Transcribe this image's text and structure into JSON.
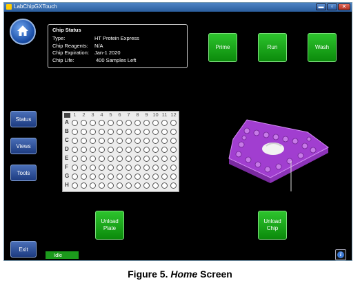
{
  "window": {
    "title": "LabChipGXTouch",
    "controls": {
      "minimize": "▬",
      "maximize": "▫",
      "close": "✕"
    }
  },
  "sidebar": {
    "items": [
      {
        "label": "Status"
      },
      {
        "label": "Views"
      },
      {
        "label": "Tools"
      }
    ],
    "exit_label": "Exit"
  },
  "chip_status": {
    "heading": "Chip Status",
    "rows": [
      {
        "key": "Type:",
        "value": "HT Protein Express"
      },
      {
        "key": "Chip Reagents:",
        "value": "N/A"
      },
      {
        "key": "Chip Expiration:",
        "value": "Jan-1 2020"
      },
      {
        "key": "Chip Life:",
        "value": "400 Samples Left"
      }
    ]
  },
  "actions": {
    "prime": "Prime",
    "run": "Run",
    "wash": "Wash",
    "unload_plate": [
      "Unload",
      "Plate"
    ],
    "unload_chip": [
      "Unload",
      "Chip"
    ]
  },
  "plate": {
    "columns": [
      "1",
      "2",
      "3",
      "4",
      "5",
      "6",
      "7",
      "8",
      "9",
      "10",
      "11",
      "12"
    ],
    "rows": [
      "A",
      "B",
      "C",
      "D",
      "E",
      "F",
      "G",
      "H"
    ]
  },
  "status": {
    "text": "Idle"
  },
  "info_icon": "i",
  "caption": {
    "prefix": "Figure 5. ",
    "emph": "Home",
    "suffix": " Screen"
  },
  "colors": {
    "action_green": "#1aa81a",
    "nav_blue": "#2a4f9c",
    "chip_purple": "#b44fe0"
  }
}
